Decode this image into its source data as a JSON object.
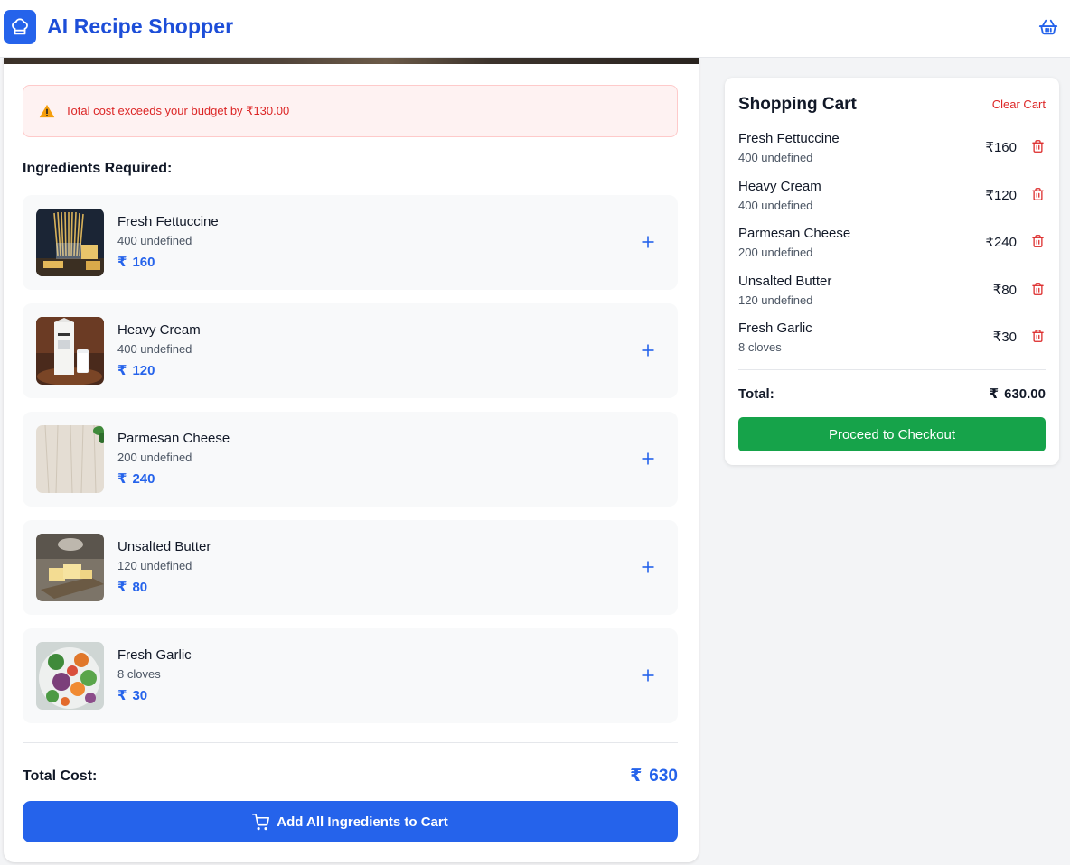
{
  "header": {
    "app_title": "AI Recipe Shopper",
    "logo_icon": "chef-hat-icon",
    "basket_icon": "basket-icon",
    "brand_color": "#2563eb"
  },
  "main": {
    "alert": {
      "icon": "warning-icon",
      "text": "Total cost exceeds your budget by ₹130.00"
    },
    "section_title": "Ingredients Required:",
    "currency_symbol": "₹",
    "ingredients": [
      {
        "name": "Fresh Fettuccine",
        "quantity": "400 undefined",
        "price": "160",
        "image": "pasta-image"
      },
      {
        "name": "Heavy Cream",
        "quantity": "400 undefined",
        "price": "120",
        "image": "cream-image"
      },
      {
        "name": "Parmesan Cheese",
        "quantity": "200 undefined",
        "price": "240",
        "image": "cheese-image"
      },
      {
        "name": "Unsalted Butter",
        "quantity": "120 undefined",
        "price": "80",
        "image": "butter-image"
      },
      {
        "name": "Fresh Garlic",
        "quantity": "8 cloves",
        "price": "30",
        "image": "salad-image"
      }
    ],
    "total_label": "Total Cost:",
    "total_value": "630",
    "add_all_label": "Add All Ingredients to Cart"
  },
  "cart": {
    "title": "Shopping Cart",
    "clear_label": "Clear Cart",
    "items": [
      {
        "name": "Fresh Fettuccine",
        "quantity": "400 undefined",
        "price": "₹160"
      },
      {
        "name": "Heavy Cream",
        "quantity": "400 undefined",
        "price": "₹120"
      },
      {
        "name": "Parmesan Cheese",
        "quantity": "200 undefined",
        "price": "₹240"
      },
      {
        "name": "Unsalted Butter",
        "quantity": "120 undefined",
        "price": "₹80"
      },
      {
        "name": "Fresh Garlic",
        "quantity": "8 cloves",
        "price": "₹30"
      }
    ],
    "total_label": "Total:",
    "total_currency": "₹",
    "total_value": "630.00",
    "checkout_label": "Proceed to Checkout",
    "checkout_color": "#16a34a",
    "danger_color": "#dc2626"
  }
}
